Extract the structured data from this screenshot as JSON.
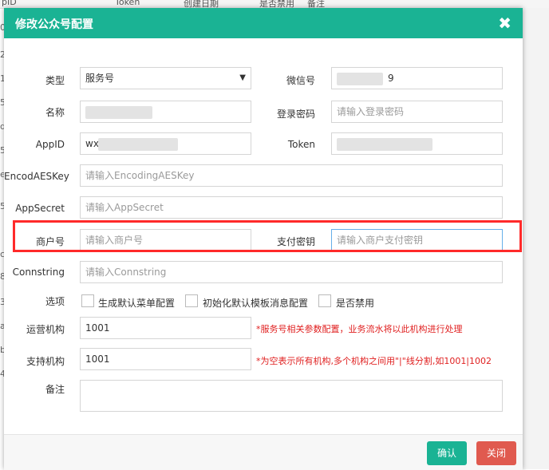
{
  "background": {
    "columns": [
      "pID",
      "Token",
      "创建日期",
      "是否禁用",
      "备注"
    ],
    "row_chars": [
      "0",
      "2",
      "1",
      "5",
      "d",
      "5",
      "e",
      "5",
      "c",
      "8",
      "",
      "3",
      "a",
      "b",
      "4"
    ]
  },
  "modal": {
    "title": "修改公众号配置",
    "close_glyph": "✖",
    "fields": {
      "type": {
        "label": "类型",
        "value": "服务号"
      },
      "wechat_id": {
        "label": "微信号",
        "value": "9"
      },
      "name": {
        "label": "名称",
        "value": ""
      },
      "login_password": {
        "label": "登录密码",
        "placeholder": "请输入登录密码"
      },
      "appid": {
        "label": "AppID",
        "value": "wx"
      },
      "token": {
        "label": "Token",
        "value": ""
      },
      "encoding_aes_key": {
        "label": "EncodAESKey",
        "placeholder": "请输入EncodingAESKey"
      },
      "app_secret": {
        "label": "AppSecret",
        "placeholder": "请输入AppSecret"
      },
      "merchant_id": {
        "label": "商户号",
        "placeholder": "请输入商户号"
      },
      "pay_key": {
        "label": "支付密钥",
        "placeholder": "请输入商户支付密钥"
      },
      "connstring": {
        "label": "Connstring",
        "placeholder": "请输入Connstring"
      },
      "options": {
        "label": "选项",
        "items": [
          "生成默认菜单配置",
          "初始化默认模板消息配置",
          "是否禁用"
        ]
      },
      "operating_org": {
        "label": "运营机构",
        "value": "1001",
        "hint": "*服务号相关参数配置，业务流水将以此机构进行处理"
      },
      "support_org": {
        "label": "支持机构",
        "value": "1001",
        "hint": "*为空表示所有机构,多个机构之间用\"|\"线分割,如1001|1002"
      },
      "remark": {
        "label": "备注",
        "value": ""
      }
    },
    "buttons": {
      "confirm": "确认",
      "close": "关闭"
    },
    "colors": {
      "header": "#1ab394",
      "confirm": "#1ab394",
      "close": "#e05a4f",
      "highlight": "#ff2a2a",
      "hint": "#e02020"
    }
  }
}
